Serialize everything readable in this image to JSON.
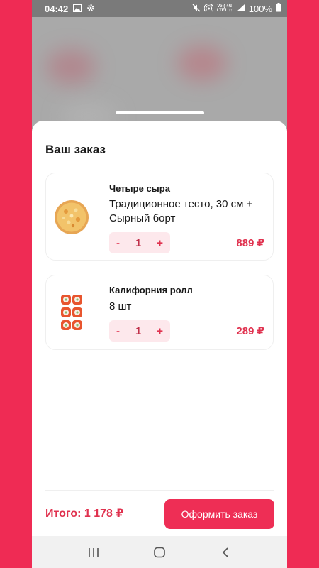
{
  "status_bar": {
    "time": "04:42",
    "network_top": "Vo)) 4G",
    "network_bottom": "LTE1 ↓↑",
    "battery": "100%"
  },
  "order": {
    "title": "Ваш заказ",
    "items": [
      {
        "name": "Четыре сыра",
        "description": "Традиционное тесто, 30 см + Сырный борт",
        "minus": "-",
        "quantity": "1",
        "plus": "+",
        "price": "889 ₽",
        "icon": "pizza-image"
      },
      {
        "name": "Калифорния ролл",
        "description": "8 шт",
        "minus": "-",
        "quantity": "1",
        "plus": "+",
        "price": "289 ₽",
        "icon": "sushi-roll-image"
      }
    ],
    "total": "Итого: 1 178 ₽",
    "checkout_label": "Оформить заказ"
  },
  "colors": {
    "accent": "#ee2e55",
    "background": "#ef2b54",
    "stepper_bg": "#fde8ec"
  }
}
